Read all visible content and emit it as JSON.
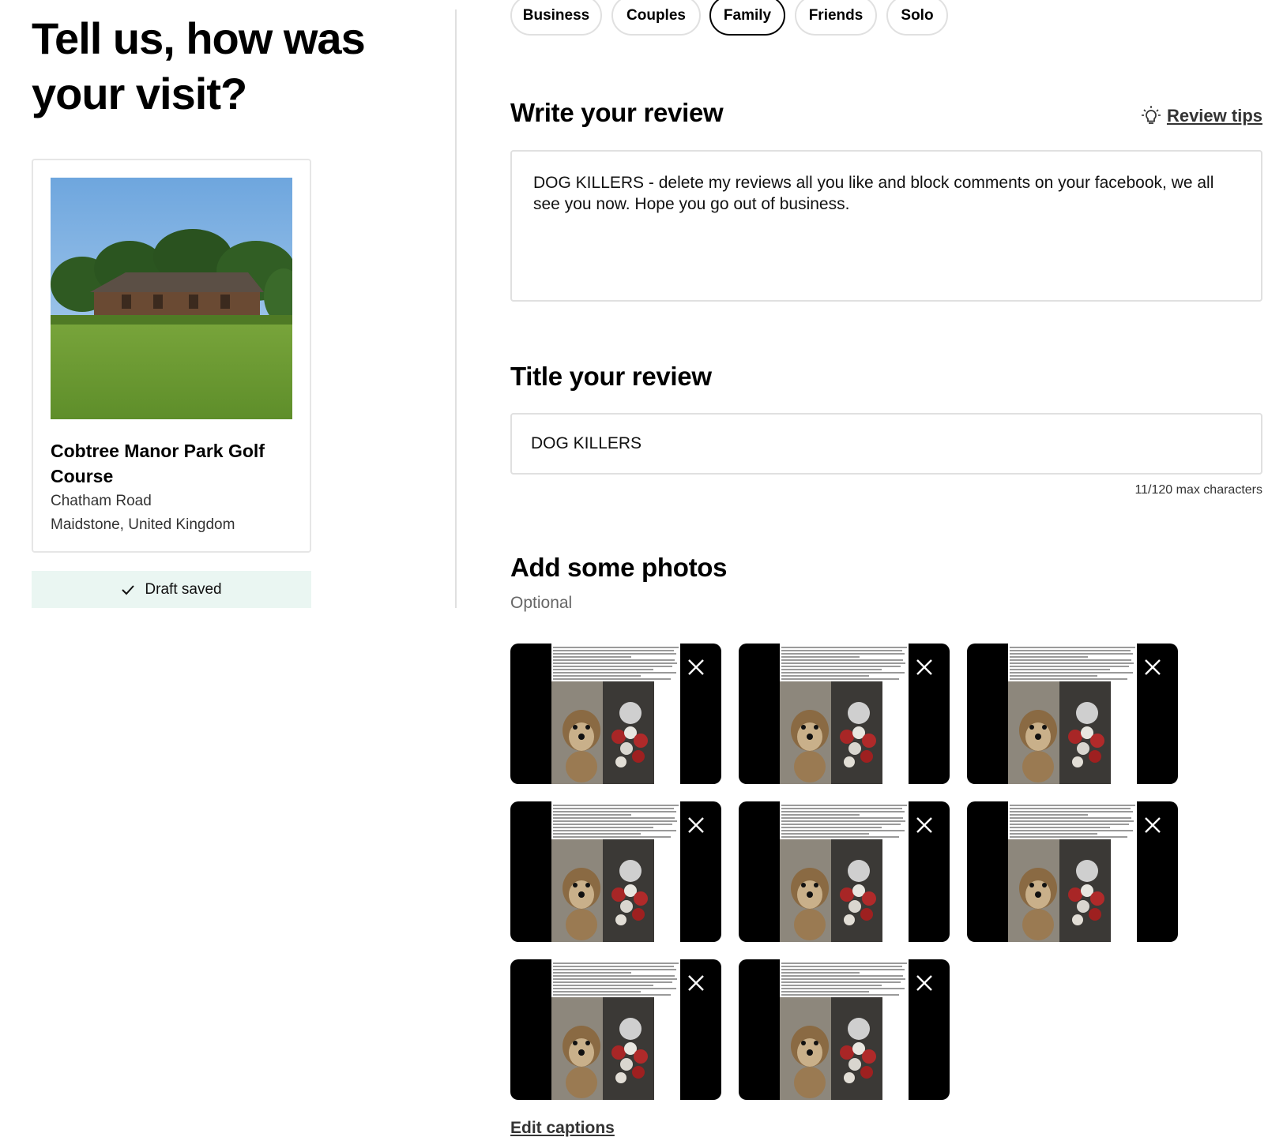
{
  "page": {
    "title": "Tell us, how was your visit?"
  },
  "place": {
    "name": "Cobtree Manor Park Golf Course",
    "address_line1": "Chatham Road",
    "address_line2": "Maidstone, United Kingdom"
  },
  "draft": {
    "status": "Draft saved"
  },
  "trip_type": {
    "options": [
      "Business",
      "Couples",
      "Family",
      "Friends",
      "Solo"
    ],
    "selected": "Family"
  },
  "review": {
    "heading": "Write your review",
    "tips_label": "Review tips",
    "text": "DOG KILLERS - delete my reviews all you like and block comments on your facebook, we all see you now. Hope you go out of business."
  },
  "title_section": {
    "heading": "Title your review",
    "value": "DOG KILLERS",
    "char_count": "11/120 max characters"
  },
  "photos": {
    "heading": "Add some photos",
    "optional_label": "Optional",
    "count": 8,
    "edit_captions_label": "Edit captions"
  },
  "colors": {
    "draft_banner_bg": "#eaf6f2",
    "border": "#e0e0e0",
    "selected_chip_border": "#000000"
  },
  "icons": [
    "check-icon",
    "lightbulb-icon",
    "close-icon"
  ]
}
